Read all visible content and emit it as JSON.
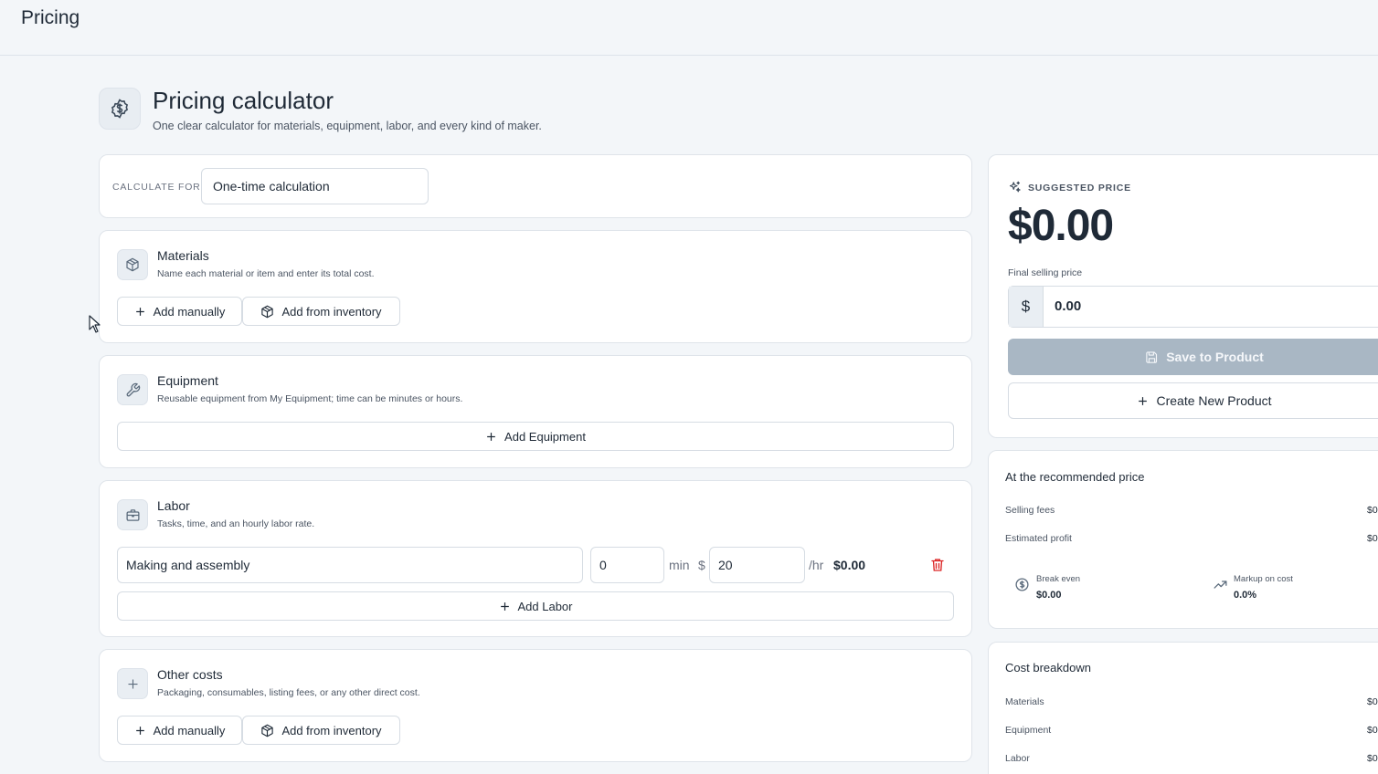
{
  "topbar": {
    "title": "Pricing"
  },
  "header": {
    "title": "Pricing calculator",
    "subtitle": "One clear calculator for materials, equipment, labor, and every kind of maker."
  },
  "calculate_for": {
    "label": "CALCULATE FOR",
    "value": "One-time calculation"
  },
  "materials": {
    "title": "Materials",
    "subtitle": "Name each material or item and enter its total cost.",
    "add_manually": "Add manually",
    "add_inventory": "Add from inventory"
  },
  "equipment": {
    "title": "Equipment",
    "subtitle": "Reusable equipment from My Equipment; time can be minutes or hours.",
    "add_button": "Add Equipment"
  },
  "labor": {
    "title": "Labor",
    "subtitle": "Tasks, time, and an hourly labor rate.",
    "rows": [
      {
        "task": "Making and assembly",
        "minutes": "0",
        "min_unit": "min",
        "currency": "$",
        "rate": "20",
        "rate_unit": "/hr",
        "total": "$0.00"
      }
    ],
    "add_button": "Add Labor"
  },
  "other_costs": {
    "title": "Other costs",
    "subtitle": "Packaging, consumables, listing fees, or any other direct cost.",
    "add_manually": "Add manually",
    "add_inventory": "Add from inventory"
  },
  "suggested": {
    "label": "SUGGESTED PRICE",
    "price": "$0.00",
    "final_label": "Final selling price",
    "currency": "$",
    "final_value": "0.00",
    "save_button": "Save to Product",
    "create_button": "Create New Product"
  },
  "recommended": {
    "title": "At the recommended price",
    "rows": [
      {
        "label": "Selling fees",
        "value": "$0"
      },
      {
        "label": "Estimated profit",
        "value": "$0"
      }
    ],
    "break_even": {
      "label": "Break even",
      "value": "$0.00"
    },
    "markup": {
      "label": "Markup on cost",
      "value": "0.0%"
    }
  },
  "breakdown": {
    "title": "Cost breakdown",
    "rows": [
      {
        "label": "Materials",
        "value": "$0"
      },
      {
        "label": "Equipment",
        "value": "$0"
      },
      {
        "label": "Labor",
        "value": "$0"
      }
    ]
  }
}
